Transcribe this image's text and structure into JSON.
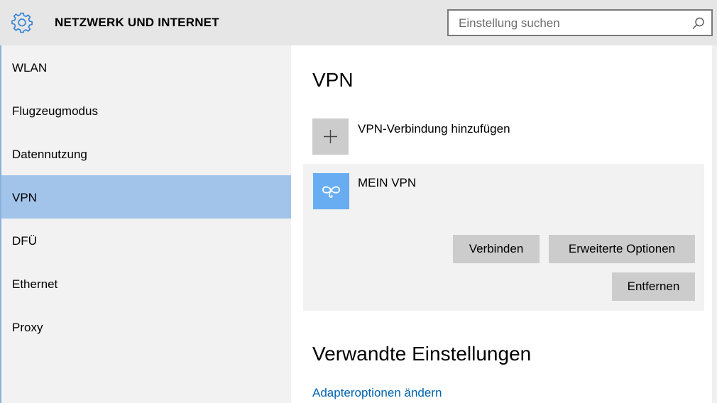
{
  "header": {
    "title": "NETZWERK UND INTERNET",
    "search_placeholder": "Einstellung suchen",
    "icons": {
      "app": "gear-icon",
      "search": "search-icon"
    }
  },
  "sidebar": {
    "items": [
      {
        "label": "WLAN",
        "active": false
      },
      {
        "label": "Flugzeugmodus",
        "active": false
      },
      {
        "label": "Datennutzung",
        "active": false
      },
      {
        "label": "VPN",
        "active": true
      },
      {
        "label": "DFÜ",
        "active": false
      },
      {
        "label": "Ethernet",
        "active": false
      },
      {
        "label": "Proxy",
        "active": false
      }
    ]
  },
  "main": {
    "title": "VPN",
    "add_label": "VPN-Verbindung hinzufügen",
    "connection": {
      "name": "MEIN VPN",
      "connect_label": "Verbinden",
      "advanced_label": "Erweiterte Optionen",
      "remove_label": "Entfernen"
    },
    "related_title": "Verwandte Einstellungen",
    "related_link": "Adapteroptionen ändern"
  },
  "colors": {
    "accent": "#0063b1",
    "sidebar_active": "#a3c4ea",
    "vpn_tile": "#68adf2",
    "button": "#cccccc"
  }
}
